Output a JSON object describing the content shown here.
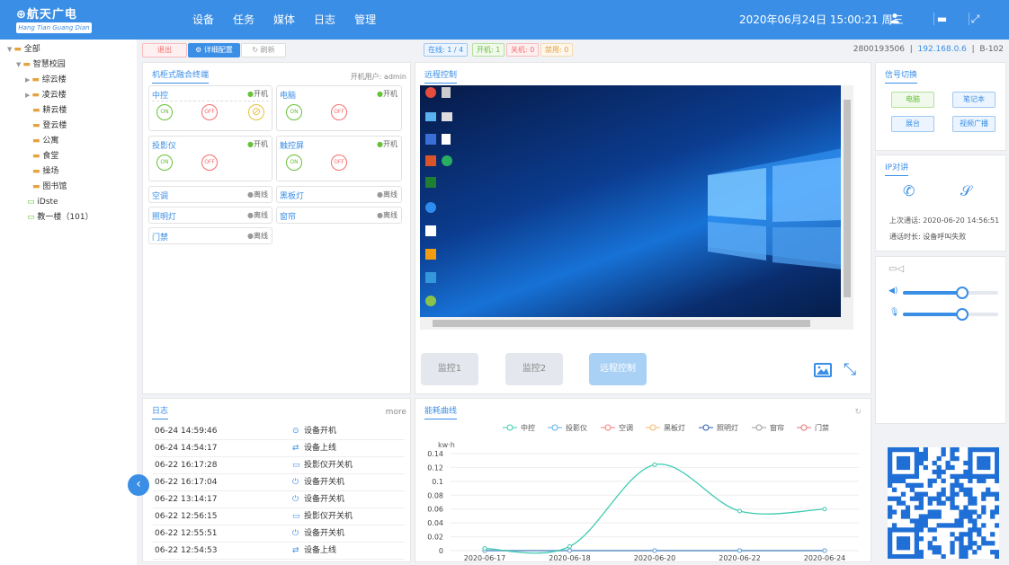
{
  "brand": {
    "name": "⊕航天广电",
    "sub": "Hang Tian Guang Dian"
  },
  "nav": [
    "设备",
    "任务",
    "媒体",
    "日志",
    "管理"
  ],
  "datetime": "2020年06月24日 15:00:21  周三",
  "tree": [
    {
      "label": "全部",
      "level": 0,
      "folder": true
    },
    {
      "label": "智慧校园",
      "level": 1,
      "folder": true
    },
    {
      "label": "综云楼",
      "level": 2,
      "folder": true
    },
    {
      "label": "凌云楼",
      "level": 2,
      "folder": true
    },
    {
      "label": "耕云楼",
      "level": 2,
      "folder": true
    },
    {
      "label": "登云楼",
      "level": 2,
      "folder": true
    },
    {
      "label": "公寓",
      "level": 2,
      "folder": true
    },
    {
      "label": "食堂",
      "level": 2,
      "folder": true
    },
    {
      "label": "操场",
      "level": 2,
      "folder": true
    },
    {
      "label": "图书馆",
      "level": 2,
      "folder": true
    },
    {
      "label": "iDste",
      "level": 1,
      "folder": false
    },
    {
      "label": "教一楼（101）",
      "level": 1,
      "folder": false
    }
  ],
  "toolbar": {
    "exit": "退出",
    "config": "⚙ 详细配置",
    "refresh": "↻ 刷新"
  },
  "status": {
    "online": "在线: 1 / 4",
    "on": "开机: 1",
    "off": "关机: 0",
    "disabled": "禁用: 0"
  },
  "device_info": {
    "id": "2800193506",
    "ip": "192.168.0.6",
    "room": "B-102"
  },
  "terminal": {
    "title": "机柜式融合终端",
    "user": "开机用户: admin",
    "devices": [
      {
        "name": "中控",
        "status": "开机"
      },
      {
        "name": "电脑",
        "status": "开机"
      },
      {
        "name": "投影仪",
        "status": "开机"
      },
      {
        "name": "触控屏",
        "status": "开机"
      },
      {
        "name": "空调",
        "status": "离线"
      },
      {
        "name": "黑板灯",
        "status": "离线"
      },
      {
        "name": "照明灯",
        "status": "离线"
      },
      {
        "name": "窗帘",
        "status": "离线"
      },
      {
        "name": "门禁",
        "status": "离线"
      }
    ]
  },
  "remote": {
    "title": "远程控制",
    "btn1": "监控1",
    "btn2": "监控2",
    "btn3": "远程控制"
  },
  "signal": {
    "title": "信号切换",
    "options": [
      "电脑",
      "笔记本",
      "展台",
      "视频广播"
    ]
  },
  "ip_talk": {
    "title": "IP对讲",
    "last_call": "上次通话: 2020-06-20 14:56:51",
    "duration": "通话时长: 设备呼叫失败"
  },
  "volume": {
    "speaker": 0.62,
    "mic": 0.62
  },
  "logs": {
    "title": "日志",
    "more": "more",
    "rows": [
      {
        "time": "06-24 14:59:46",
        "event": "设备开机",
        "icon": "⊙"
      },
      {
        "time": "06-24 14:54:17",
        "event": "设备上线",
        "icon": "⇄"
      },
      {
        "time": "06-22 16:17:28",
        "event": "投影仪开关机",
        "icon": "▭"
      },
      {
        "time": "06-22 16:17:04",
        "event": "设备开关机",
        "icon": "⏻"
      },
      {
        "time": "06-22 13:14:17",
        "event": "设备开关机",
        "icon": "⏻"
      },
      {
        "time": "06-22 12:56:15",
        "event": "投影仪开关机",
        "icon": "▭"
      },
      {
        "time": "06-22 12:55:51",
        "event": "设备开关机",
        "icon": "⏻"
      },
      {
        "time": "06-22 12:54:53",
        "event": "设备上线",
        "icon": "⇄"
      }
    ]
  },
  "chart_data": {
    "type": "line",
    "title": "能耗曲线",
    "ylabel": "kw·h",
    "ylim": [
      0,
      0.14
    ],
    "yticks": [
      "0.14",
      "0.12",
      "0.1",
      "0.08",
      "0.06",
      "0.04",
      "0.02",
      "0"
    ],
    "categories": [
      "2020-06-17",
      "2020-06-18",
      "2020-06-20",
      "2020-06-22",
      "2020-06-24"
    ],
    "series": [
      {
        "name": "中控",
        "color": "#3ecbb0",
        "values": [
          0.003,
          0.006,
          0.124,
          0.057,
          0.06
        ]
      },
      {
        "name": "投影仪",
        "color": "#5ab1ef",
        "values": [
          0,
          0,
          0,
          0,
          0
        ]
      },
      {
        "name": "空调",
        "color": "#f57b7b",
        "values": [
          0,
          0,
          0,
          0,
          0
        ]
      },
      {
        "name": "黑板灯",
        "color": "#f5b46b",
        "values": [
          0,
          0,
          0,
          0,
          0
        ]
      },
      {
        "name": "照明灯",
        "color": "#2d5bb5",
        "values": [
          0,
          0,
          0,
          0,
          0
        ]
      },
      {
        "name": "窗帘",
        "color": "#9a9a9a",
        "values": [
          0,
          0,
          0,
          0,
          0
        ]
      },
      {
        "name": "门禁",
        "color": "#e07070",
        "values": [
          0,
          0,
          0,
          0,
          0
        ]
      }
    ]
  }
}
